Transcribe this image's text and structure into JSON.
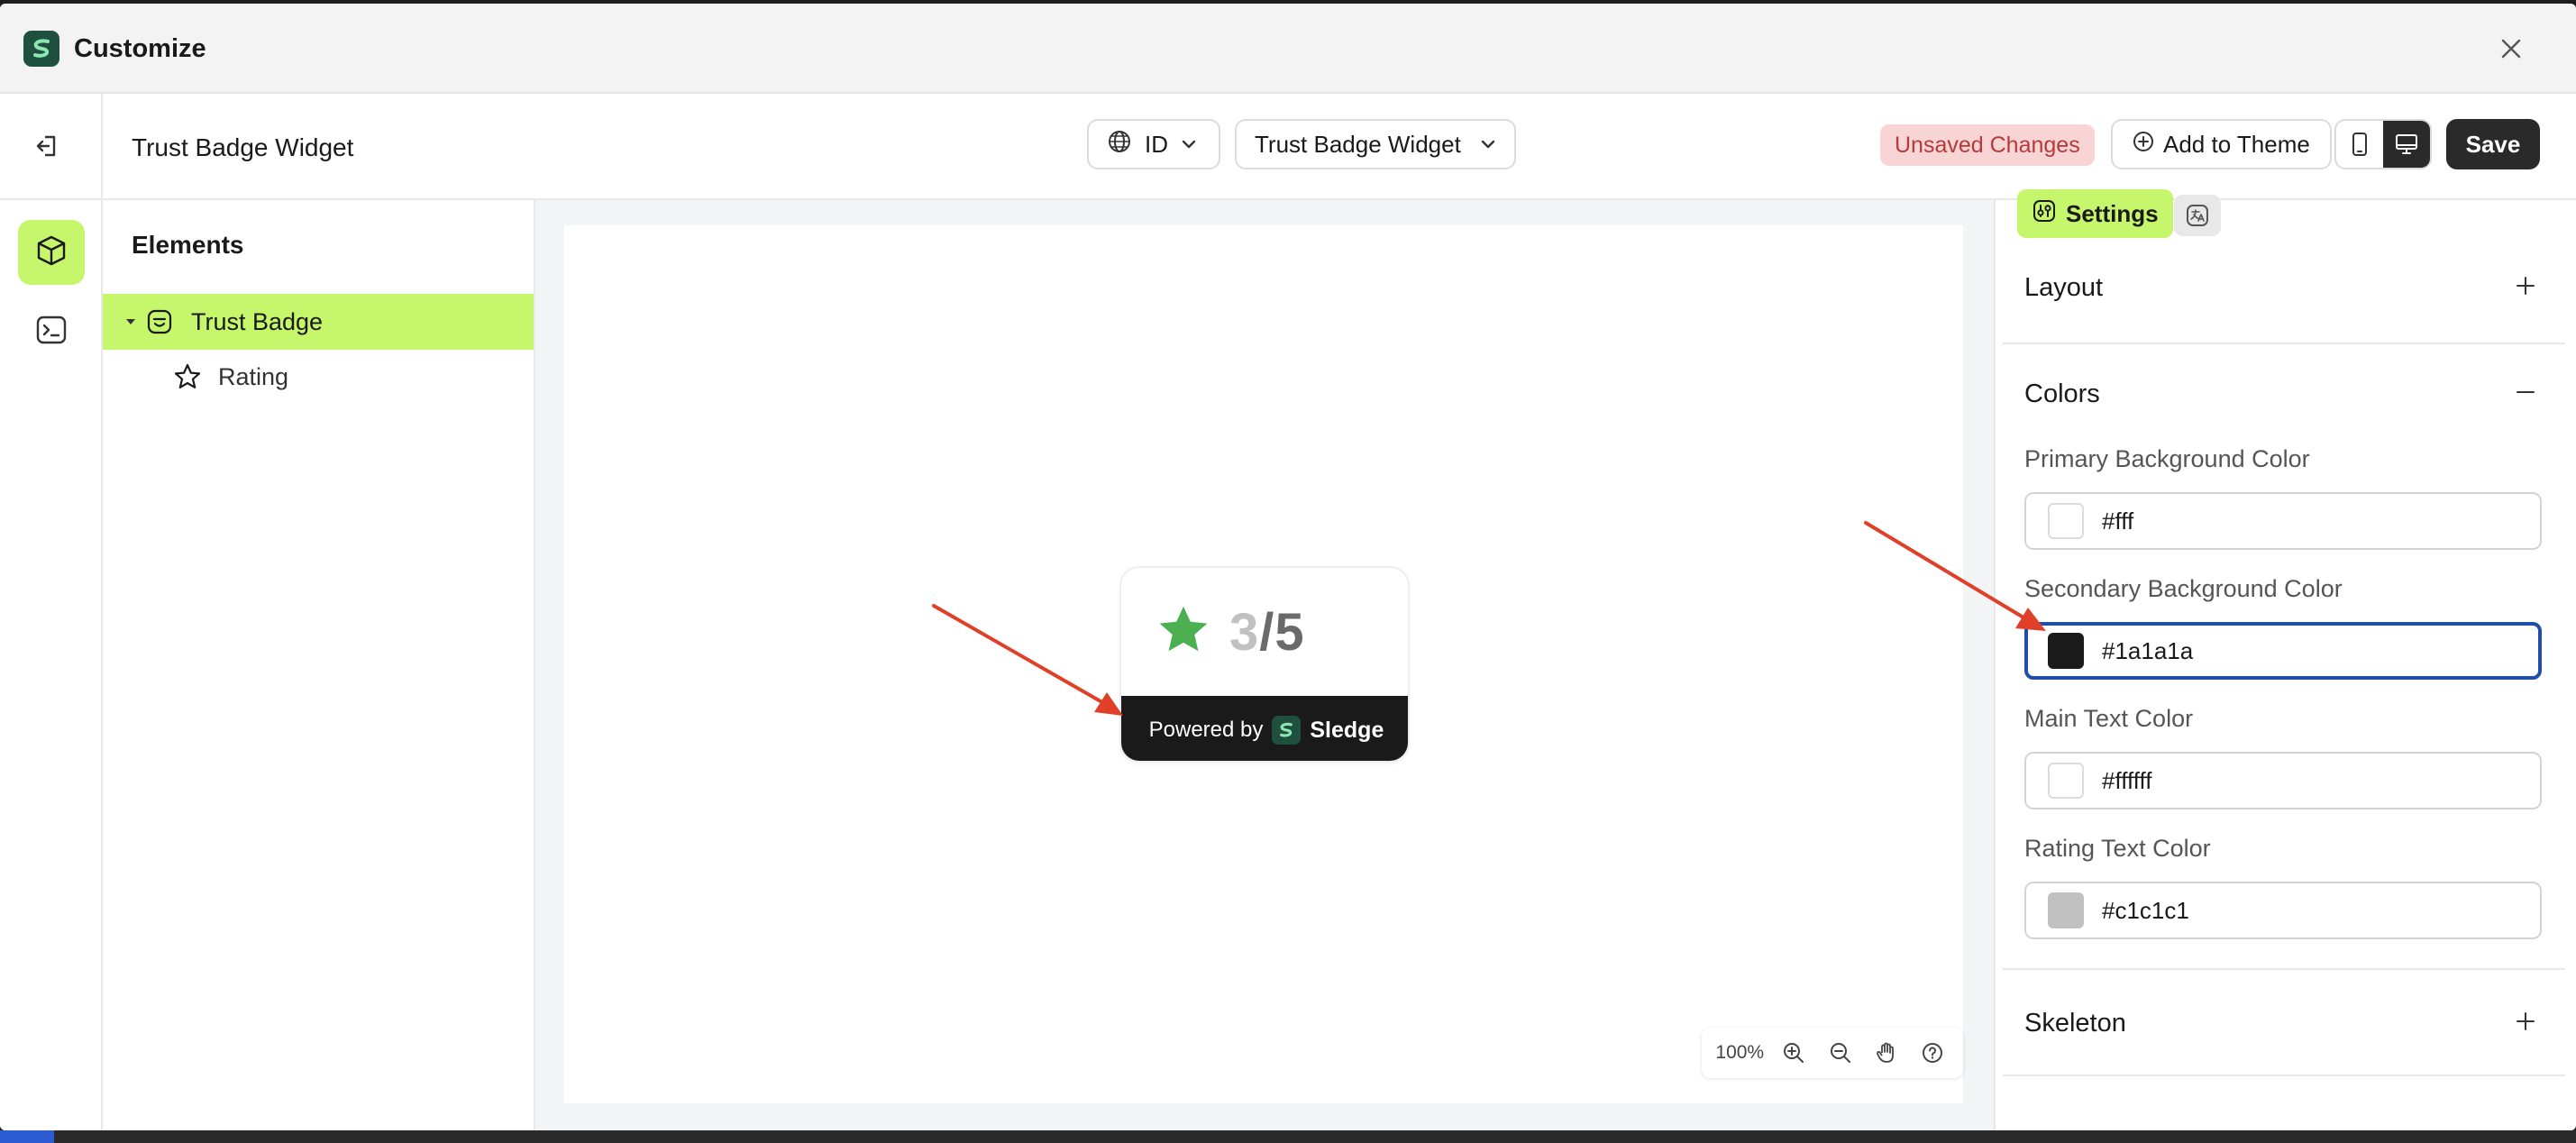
{
  "window": {
    "title": "Customize"
  },
  "toolbar": {
    "page_title": "Trust Badge Widget",
    "language": "ID",
    "widget_selector": "Trust Badge Widget",
    "unsaved_label": "Unsaved Changes",
    "add_to_theme_label": "Add to Theme",
    "save_label": "Save",
    "active_device": "desktop"
  },
  "elements_panel": {
    "heading": "Elements",
    "tree": [
      {
        "label": "Trust Badge",
        "selected": true,
        "expanded": true
      },
      {
        "label": "Rating",
        "selected": false
      }
    ]
  },
  "preview": {
    "rating_value": "3",
    "rating_separator": "/",
    "rating_max": "5",
    "footer_text": "Powered by",
    "footer_brand": "Sledge",
    "zoom_level": "100%"
  },
  "settings": {
    "tabs": [
      {
        "label": "Settings",
        "active": true
      },
      {
        "label": "",
        "icon": "translate-icon",
        "active": false
      }
    ],
    "sections": {
      "layout": {
        "title": "Layout",
        "expanded": false
      },
      "colors": {
        "title": "Colors",
        "expanded": true,
        "fields": [
          {
            "label": "Primary Background Color",
            "value": "#fff",
            "swatch": "#ffffff",
            "focused": false
          },
          {
            "label": "Secondary Background Color",
            "value": "#1a1a1a",
            "swatch": "#1a1a1a",
            "focused": true
          },
          {
            "label": "Main Text Color",
            "value": "#ffffff",
            "swatch": "#ffffff",
            "focused": false
          },
          {
            "label": "Rating Text Color",
            "value": "#c1c1c1",
            "swatch": "#c1c1c1",
            "focused": false
          }
        ]
      },
      "skeleton": {
        "title": "Skeleton",
        "expanded": false
      }
    }
  },
  "colors": {
    "accent": "#c6f66b",
    "brand": "#1f4f3f",
    "annotation_arrow": "#e0402a",
    "focus_ring": "#1f4fa6"
  }
}
